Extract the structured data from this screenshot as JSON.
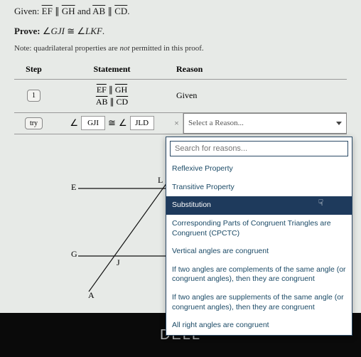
{
  "given": {
    "label": "Given:",
    "seg1a": "EF",
    "par1": "∥",
    "seg1b": "GH",
    "and": "and",
    "seg2a": "AB",
    "par2": "∥",
    "seg2b": "CD",
    "period": "."
  },
  "prove": {
    "label": "Prove:",
    "angle": "∠",
    "a1": "GJI",
    "cong": "≅",
    "a2": "LKF",
    "period": "."
  },
  "note": {
    "prefix": "Note: quadrilateral properties are ",
    "not": "not",
    "suffix": " permitted in this proof."
  },
  "table": {
    "head": {
      "step": "Step",
      "statement": "Statement",
      "reason": "Reason"
    },
    "row1": {
      "step": "1",
      "statement_l1_a": "EF",
      "statement_l1_mid": "∥",
      "statement_l1_b": "GH",
      "statement_l2_a": "AB",
      "statement_l2_mid": "∥",
      "statement_l2_b": "CD",
      "reason": "Given"
    },
    "row2": {
      "step": "try",
      "angle1": "∠",
      "val1": "GJI",
      "cong": "≅",
      "angle2": "∠",
      "val2": "JLD",
      "x": "×",
      "reason_placeholder": "Select a Reason..."
    }
  },
  "dropdown": {
    "search_placeholder": "Search for reasons...",
    "items": {
      "0": "Reflexive Property",
      "1": "Transitive Property",
      "2": "Substitution",
      "3": "Corresponding Parts of Congruent Triangles are Congruent (CPCTC)",
      "4": "Vertical angles are congruent",
      "5": "If two angles are complements of the same angle (or congruent angles), then they are congruent",
      "6": "If two angles are supplements of the same angle (or congruent angles), then they are congruent",
      "7": "All right angles are congruent"
    }
  },
  "diagram": {
    "E": "E",
    "L": "L",
    "G": "G",
    "J": "J",
    "A": "A"
  },
  "brand": "DELL"
}
